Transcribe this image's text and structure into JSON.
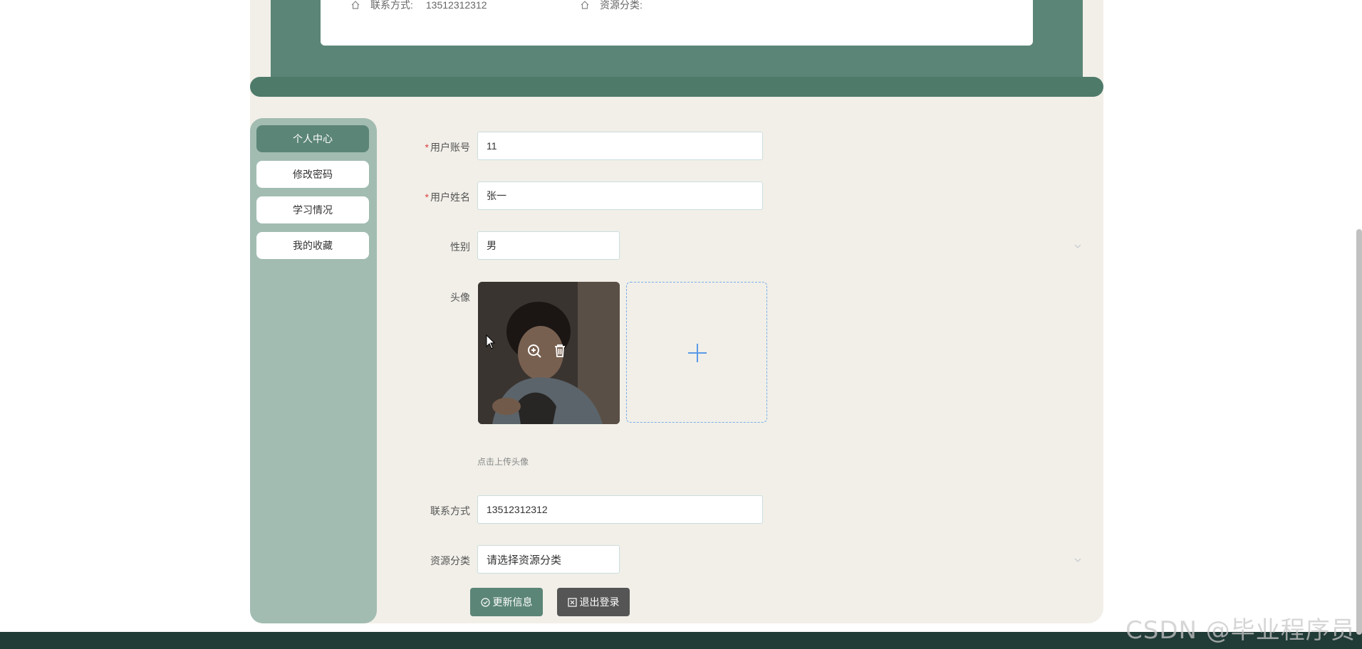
{
  "header": {
    "contact_label": "联系方式:",
    "contact_value": "13512312312",
    "category_label": "资源分类:",
    "category_value": ""
  },
  "sidebar": {
    "items": [
      {
        "label": "个人中心",
        "active": true
      },
      {
        "label": "修改密码",
        "active": false
      },
      {
        "label": "学习情况",
        "active": false
      },
      {
        "label": "我的收藏",
        "active": false
      }
    ]
  },
  "form": {
    "account": {
      "label": "用户账号",
      "required": true,
      "value": "11"
    },
    "name": {
      "label": "用户姓名",
      "required": true,
      "value": "张一"
    },
    "gender": {
      "label": "性别",
      "value": "男"
    },
    "avatar": {
      "label": "头像",
      "hint": "点击上传头像"
    },
    "contact": {
      "label": "联系方式",
      "value": "13512312312"
    },
    "category": {
      "label": "资源分类",
      "placeholder": "请选择资源分类"
    }
  },
  "buttons": {
    "update": "更新信息",
    "logout": "退出登录"
  },
  "watermark": "CSDN @毕业程序员",
  "colors": {
    "primary": "#5b8577",
    "sidebar_bg": "#a2bcb1",
    "page_bg": "#f1efe8",
    "footer": "#213b36",
    "logout_btn": "#555555",
    "required": "#e04040",
    "upload_border": "#7aaee8"
  },
  "icons": [
    "house-icon",
    "chevron-down-icon",
    "zoom-in-icon",
    "trash-icon",
    "plus-icon",
    "check-circle-icon",
    "close-square-icon"
  ]
}
